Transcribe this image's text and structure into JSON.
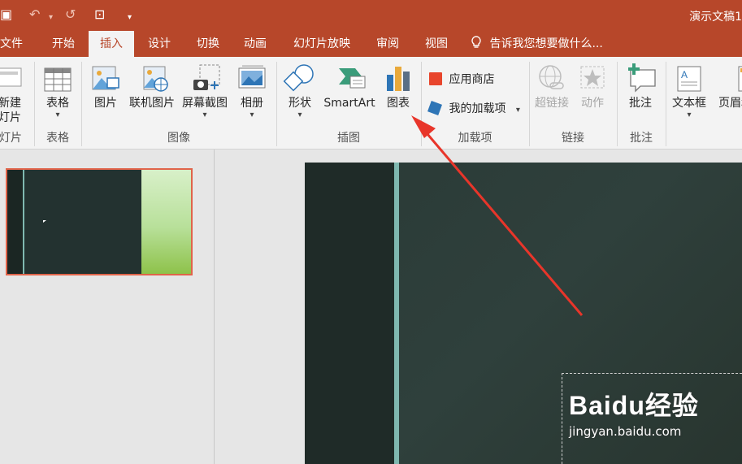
{
  "titlebar": {
    "doc_title": "演示文稿1",
    "qa_save": "▣",
    "qa_undo": "↶",
    "qa_undo_drop": "▾",
    "qa_redo": "↺",
    "qa_present": "⊡",
    "qa_customize": "▾"
  },
  "tabs": [
    "文件",
    "开始",
    "插入",
    "设计",
    "切换",
    "动画",
    "幻灯片放映",
    "审阅",
    "视图"
  ],
  "tell_me": "告诉我您想要做什么...",
  "ribbon": {
    "new_slide": {
      "line1": "新建",
      "line2": "灯片"
    },
    "table": "表格",
    "picture": "图片",
    "online_picture": "联机图片",
    "screenshot": "屏幕截图",
    "album": "相册",
    "shapes": "形状",
    "smartart": "SmartArt",
    "chart": "图表",
    "store": "应用商店",
    "my_addins": "我的加载项",
    "hyperlink": "超链接",
    "action": "动作",
    "comment": "批注",
    "textbox": "文本框",
    "header_footer": "页眉和",
    "groups": {
      "slides": "灯片",
      "tables": "表格",
      "images": "图像",
      "illustrations": "插图",
      "addins": "加载项",
      "links": "链接",
      "comments": "批注"
    }
  },
  "watermark": {
    "logo": "Baidu经验",
    "url": "jingyan.baidu.com"
  },
  "colors": {
    "brand": "#b7472a",
    "arrow": "#e8352a",
    "selection": "#e0644a"
  }
}
